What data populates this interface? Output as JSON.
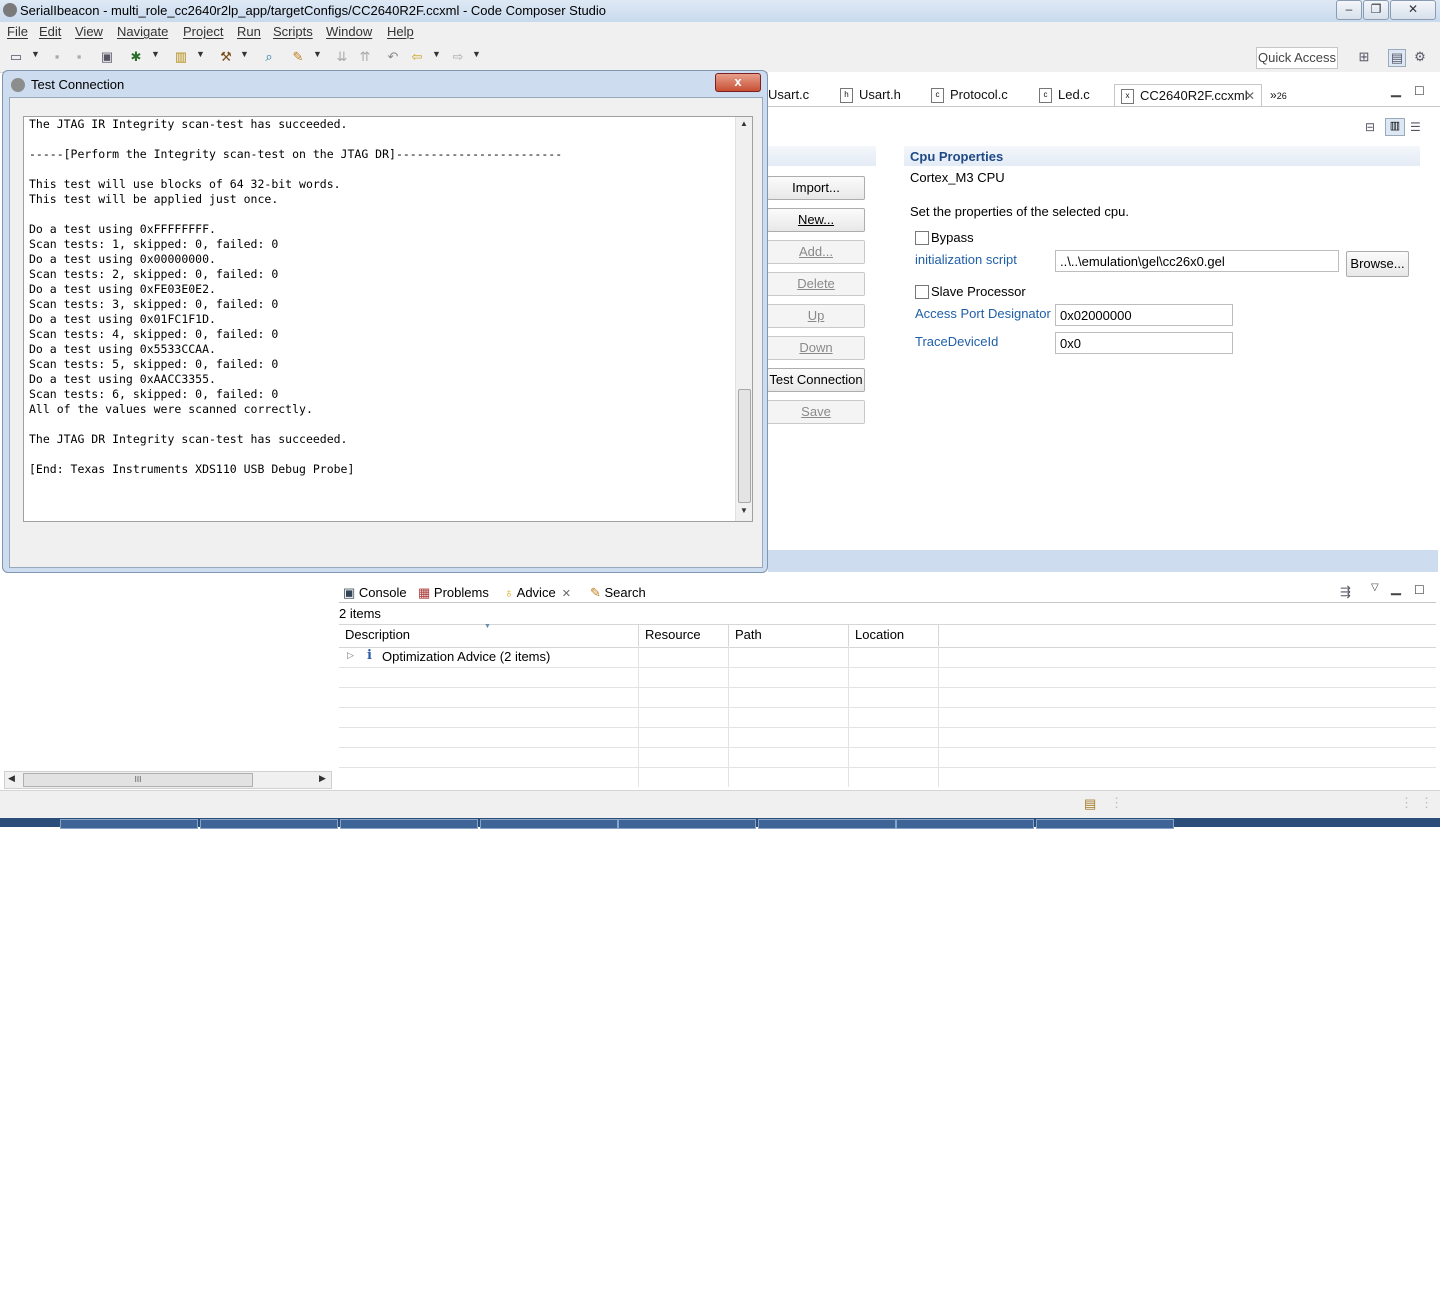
{
  "window": {
    "title": "SerialIbeacon - multi_role_cc2640r2lp_app/targetConfigs/CC2640R2F.ccxml - Code Composer Studio",
    "minimize_glyph": "–",
    "restore_glyph": "❐",
    "close_glyph": "✕"
  },
  "menu": [
    "File",
    "Edit",
    "View",
    "Navigate",
    "Project",
    "Run",
    "Scripts",
    "Window",
    "Help"
  ],
  "toolbar": {
    "quick_access": "Quick Access"
  },
  "editor": {
    "tabs": [
      "Usart.c",
      "Usart.h",
      "Protocol.c",
      "Led.c"
    ],
    "active_tab": "CC2640R2F.ccxml",
    "overflow": "»",
    "overflow_count": "26",
    "buttons": {
      "import": "Import...",
      "new": "New...",
      "add": "Add...",
      "delete": "Delete",
      "up": "Up",
      "down": "Down",
      "test_connection": "Test Connection",
      "save": "Save"
    },
    "cpu": {
      "section_title": "Cpu Properties",
      "cpu_name": "Cortex_M3 CPU",
      "description": "Set the properties of the selected cpu.",
      "bypass_label": "Bypass",
      "init_script_label": "initialization script",
      "init_script_value": "..\\..\\emulation\\gel\\cc26x0.gel",
      "browse": "Browse...",
      "slave_label": "Slave Processor",
      "access_port_label": "Access Port Designator",
      "access_port_value": "0x02000000",
      "trace_label": "TraceDeviceId",
      "trace_value": "0x0"
    }
  },
  "dialog": {
    "title": "Test Connection",
    "close_glyph": "x",
    "log": "The JTAG IR Integrity scan-test has succeeded.\n\n-----[Perform the Integrity scan-test on the JTAG DR]------------------------\n\nThis test will use blocks of 64 32-bit words.\nThis test will be applied just once.\n\nDo a test using 0xFFFFFFFF.\nScan tests: 1, skipped: 0, failed: 0\nDo a test using 0x00000000.\nScan tests: 2, skipped: 0, failed: 0\nDo a test using 0xFE03E0E2.\nScan tests: 3, skipped: 0, failed: 0\nDo a test using 0x01FC1F1D.\nScan tests: 4, skipped: 0, failed: 0\nDo a test using 0x5533CCAA.\nScan tests: 5, skipped: 0, failed: 0\nDo a test using 0xAACC3355.\nScan tests: 6, skipped: 0, failed: 0\nAll of the values were scanned correctly.\n\nThe JTAG DR Integrity scan-test has succeeded.\n\n[End: Texas Instruments XDS110 USB Debug Probe]"
  },
  "bottom": {
    "tabs": [
      "Console",
      "Problems",
      "Advice",
      "Search"
    ],
    "item_count": "2 items",
    "columns": [
      "Description",
      "Resource",
      "Path",
      "Location"
    ],
    "row_label": "Optimization Advice (2 items)",
    "row_icon": "i",
    "hscroll_grip": "III"
  }
}
